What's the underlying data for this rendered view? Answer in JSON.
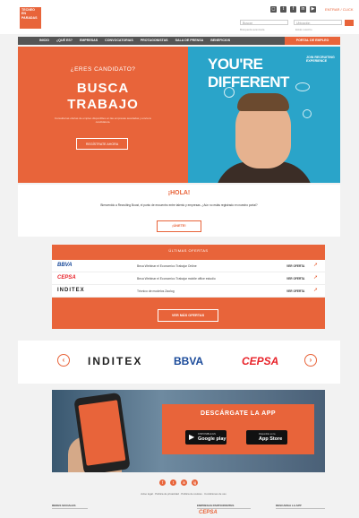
{
  "brand": {
    "logo_text": "TECNEO EN PARADAS",
    "accent": "#e8643a",
    "blue": "#2aa4c9"
  },
  "header": {
    "top_link": "ENTRAR / CLICK",
    "search_placeholder": "Buscar",
    "location_placeholder": "Ubicación",
    "sub_left": "Búsqueda avanzada",
    "sub_right": "Estás suscrito"
  },
  "nav": {
    "items": [
      "INICIO",
      "¿QUÉ ES?",
      "EMPRESAS",
      "CONVOCATORIAS",
      "PROTAGONISTAS",
      "SALA DE PRENSA",
      "BENEFICIOS"
    ],
    "cta": "PORTAL DE EMPLEO"
  },
  "hero": {
    "question": "¿ERES CANDIDATO?",
    "title_line1": "BUSCA",
    "title_line2": "TRABAJO",
    "description": "Consulta las ofertas de empleo disponibles en las empresas asociadas y envía tu candidatura.",
    "button": "REGÍSTRATE AHORA",
    "right_title": "YOU'RE DIFFERENT",
    "right_sub": "JOIN RECRUITING EXPERIENCE"
  },
  "hola": {
    "title": "¡HOLA!",
    "description": "Bienvenido a Recruiting Boost, el punto de encuentro entre talento y empresas. ¿Aún no estás registrado en nuestro portal?",
    "button": "¡ÚNETE!"
  },
  "offers": {
    "header": "ÚLTIMAS OFERTAS",
    "rows": [
      {
        "brand": "BBVA",
        "brand_color": "#1a4a9a",
        "job": "Beca Webinar el Economico Trabajar Online",
        "see": "VER OFERTA"
      },
      {
        "brand": "CEPSA",
        "brand_color": "#e8232a",
        "job": "Beca Webinar el Economico Trabajar mobile office estudio",
        "see": "VER OFERTA"
      },
      {
        "brand": "INDITEX",
        "brand_color": "#222222",
        "job": "Técnico de modelos Zaolog",
        "see": "VER OFERTA"
      }
    ],
    "button": "VER MÁS OFERTAS"
  },
  "carousel": {
    "logos": [
      {
        "name": "INDITEX",
        "color": "#222222"
      },
      {
        "name": "BBVA",
        "color": "#1a4a9a"
      },
      {
        "name": "CEPSA",
        "color": "#e8232a"
      }
    ]
  },
  "app": {
    "title": "DESCÁRGATE LA APP",
    "google": {
      "small": "DISPONIBLE EN",
      "big": "Google play"
    },
    "apple": {
      "small": "Disponible en la",
      "big": "App Store"
    }
  },
  "footer": {
    "social": [
      "f",
      "t",
      "in",
      "ig"
    ],
    "text": "Aviso legal · Política de privacidad · Política de cookies · Condiciones de uso",
    "col1": "REDES SOCIALES",
    "col2": "EMPRESAS PARTICIPANTES",
    "col3": "DESCARGA LA APP",
    "footer_logo": "CEPSA"
  }
}
